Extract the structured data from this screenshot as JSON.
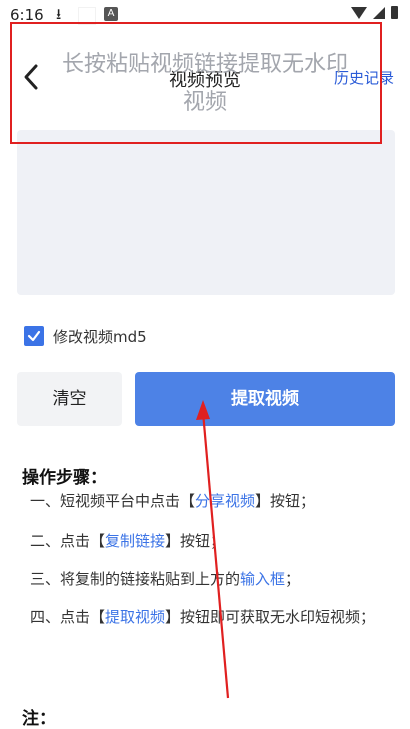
{
  "status_bar": {
    "time": "6:16",
    "app_icon_letter": "A"
  },
  "header": {
    "title": "视频预览",
    "history_label": "历史记录"
  },
  "input": {
    "placeholder_line1": "长按粘贴视频链接提取无水印",
    "placeholder_line2": "视频"
  },
  "md5": {
    "label": "修改视频md5",
    "checked": true
  },
  "buttons": {
    "clear_label": "清空",
    "extract_label": "提取视频"
  },
  "steps": {
    "title": "操作步骤：",
    "step1": {
      "prefix": "一、短视频平台中点击【",
      "highlight": "分享视频",
      "suffix": "】按钮；"
    },
    "step2": {
      "prefix": "二、点击【",
      "highlight": "复制链接",
      "suffix": "】按钮；"
    },
    "step3": {
      "prefix": "三、将复制的链接粘贴到上方的",
      "highlight": "输入框",
      "suffix": "；"
    },
    "step4": {
      "prefix": "四、点击【",
      "highlight": "提取视频",
      "suffix": "】按钮即可获取无水印短视频；"
    }
  },
  "note": {
    "title": "注："
  },
  "colors": {
    "accent": "#4d82e6",
    "link": "#3b73e6",
    "annotation": "#e02020"
  }
}
